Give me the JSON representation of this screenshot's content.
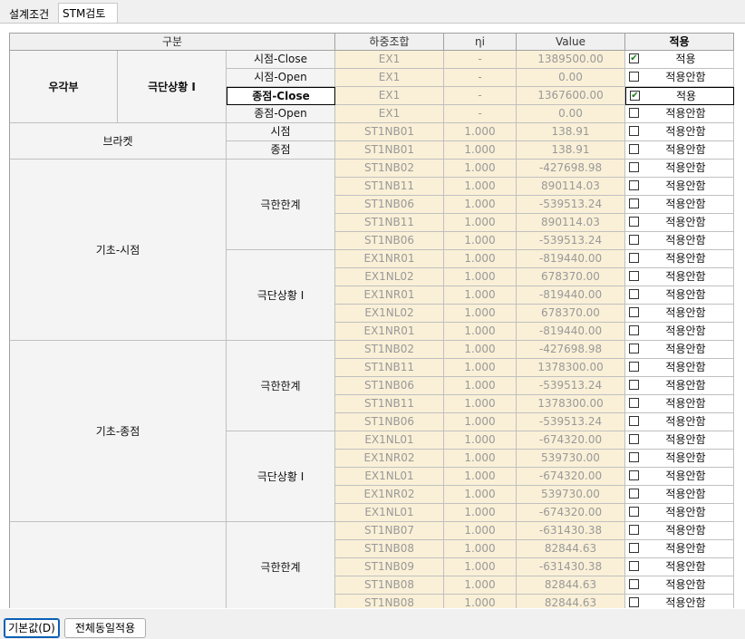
{
  "tabs": [
    {
      "label": "설계조건",
      "active": false
    },
    {
      "label": "STM검토",
      "active": true
    }
  ],
  "columns": {
    "group": "구분",
    "load": "하중조합",
    "eta": "ηi",
    "value": "Value",
    "apply": "적용"
  },
  "groups": {
    "ugakbu": "우각부",
    "ugakbu_sub": "극단상황 I",
    "bracket": "브라켓",
    "base_start": "기초-시점",
    "base_end": "기초-종점",
    "limit": "극한한계",
    "extreme": "극단상황 I"
  },
  "rows": [
    {
      "label": "시점-Close",
      "load": "EX1",
      "eta": "-",
      "value": "1389500.00",
      "apply": "적용",
      "checked": true
    },
    {
      "label": "시점-Open",
      "load": "EX1",
      "eta": "-",
      "value": "0.00",
      "apply": "적용안함",
      "checked": false
    },
    {
      "label": "종점-Close",
      "load": "EX1",
      "eta": "-",
      "value": "1367600.00",
      "apply": "적용",
      "checked": true
    },
    {
      "label": "종점-Open",
      "load": "EX1",
      "eta": "-",
      "value": "0.00",
      "apply": "적용안함",
      "checked": false
    },
    {
      "label": "시점",
      "load": "ST1NB01",
      "eta": "1.000",
      "value": "138.91",
      "apply": "적용안함",
      "checked": false
    },
    {
      "label": "종점",
      "load": "ST1NB01",
      "eta": "1.000",
      "value": "138.91",
      "apply": "적용안함",
      "checked": false
    },
    {
      "label": "",
      "load": "ST1NB02",
      "eta": "1.000",
      "value": "-427698.98",
      "apply": "적용안함",
      "checked": false
    },
    {
      "label": "",
      "load": "ST1NB11",
      "eta": "1.000",
      "value": "890114.03",
      "apply": "적용안함",
      "checked": false
    },
    {
      "label": "",
      "load": "ST1NB06",
      "eta": "1.000",
      "value": "-539513.24",
      "apply": "적용안함",
      "checked": false
    },
    {
      "label": "",
      "load": "ST1NB11",
      "eta": "1.000",
      "value": "890114.03",
      "apply": "적용안함",
      "checked": false
    },
    {
      "label": "",
      "load": "ST1NB06",
      "eta": "1.000",
      "value": "-539513.24",
      "apply": "적용안함",
      "checked": false
    },
    {
      "label": "",
      "load": "EX1NR01",
      "eta": "1.000",
      "value": "-819440.00",
      "apply": "적용안함",
      "checked": false
    },
    {
      "label": "",
      "load": "EX1NL02",
      "eta": "1.000",
      "value": "678370.00",
      "apply": "적용안함",
      "checked": false
    },
    {
      "label": "",
      "load": "EX1NR01",
      "eta": "1.000",
      "value": "-819440.00",
      "apply": "적용안함",
      "checked": false
    },
    {
      "label": "",
      "load": "EX1NL02",
      "eta": "1.000",
      "value": "678370.00",
      "apply": "적용안함",
      "checked": false
    },
    {
      "label": "",
      "load": "EX1NR01",
      "eta": "1.000",
      "value": "-819440.00",
      "apply": "적용안함",
      "checked": false
    },
    {
      "label": "",
      "load": "ST1NB02",
      "eta": "1.000",
      "value": "-427698.98",
      "apply": "적용안함",
      "checked": false
    },
    {
      "label": "",
      "load": "ST1NB11",
      "eta": "1.000",
      "value": "1378300.00",
      "apply": "적용안함",
      "checked": false
    },
    {
      "label": "",
      "load": "ST1NB06",
      "eta": "1.000",
      "value": "-539513.24",
      "apply": "적용안함",
      "checked": false
    },
    {
      "label": "",
      "load": "ST1NB11",
      "eta": "1.000",
      "value": "1378300.00",
      "apply": "적용안함",
      "checked": false
    },
    {
      "label": "",
      "load": "ST1NB06",
      "eta": "1.000",
      "value": "-539513.24",
      "apply": "적용안함",
      "checked": false
    },
    {
      "label": "",
      "load": "EX1NL01",
      "eta": "1.000",
      "value": "-674320.00",
      "apply": "적용안함",
      "checked": false
    },
    {
      "label": "",
      "load": "EX1NR02",
      "eta": "1.000",
      "value": "539730.00",
      "apply": "적용안함",
      "checked": false
    },
    {
      "label": "",
      "load": "EX1NL01",
      "eta": "1.000",
      "value": "-674320.00",
      "apply": "적용안함",
      "checked": false
    },
    {
      "label": "",
      "load": "EX1NR02",
      "eta": "1.000",
      "value": "539730.00",
      "apply": "적용안함",
      "checked": false
    },
    {
      "label": "",
      "load": "EX1NL01",
      "eta": "1.000",
      "value": "-674320.00",
      "apply": "적용안함",
      "checked": false
    },
    {
      "label": "",
      "load": "ST1NB07",
      "eta": "1.000",
      "value": "-631430.38",
      "apply": "적용안함",
      "checked": false
    },
    {
      "label": "",
      "load": "ST1NB08",
      "eta": "1.000",
      "value": "82844.63",
      "apply": "적용안함",
      "checked": false
    },
    {
      "label": "",
      "load": "ST1NB09",
      "eta": "1.000",
      "value": "-631430.38",
      "apply": "적용안함",
      "checked": false
    },
    {
      "label": "",
      "load": "ST1NB08",
      "eta": "1.000",
      "value": "82844.63",
      "apply": "적용안함",
      "checked": false
    },
    {
      "label": "",
      "load": "ST1NB08",
      "eta": "1.000",
      "value": "82844.63",
      "apply": "적용안함",
      "checked": false
    }
  ],
  "buttons": {
    "default": "기본값(D)",
    "apply_all": "전체동일적용"
  },
  "colors": {
    "readonly_cell": "#faf0d7",
    "check_mark": "#1a7f1a"
  }
}
